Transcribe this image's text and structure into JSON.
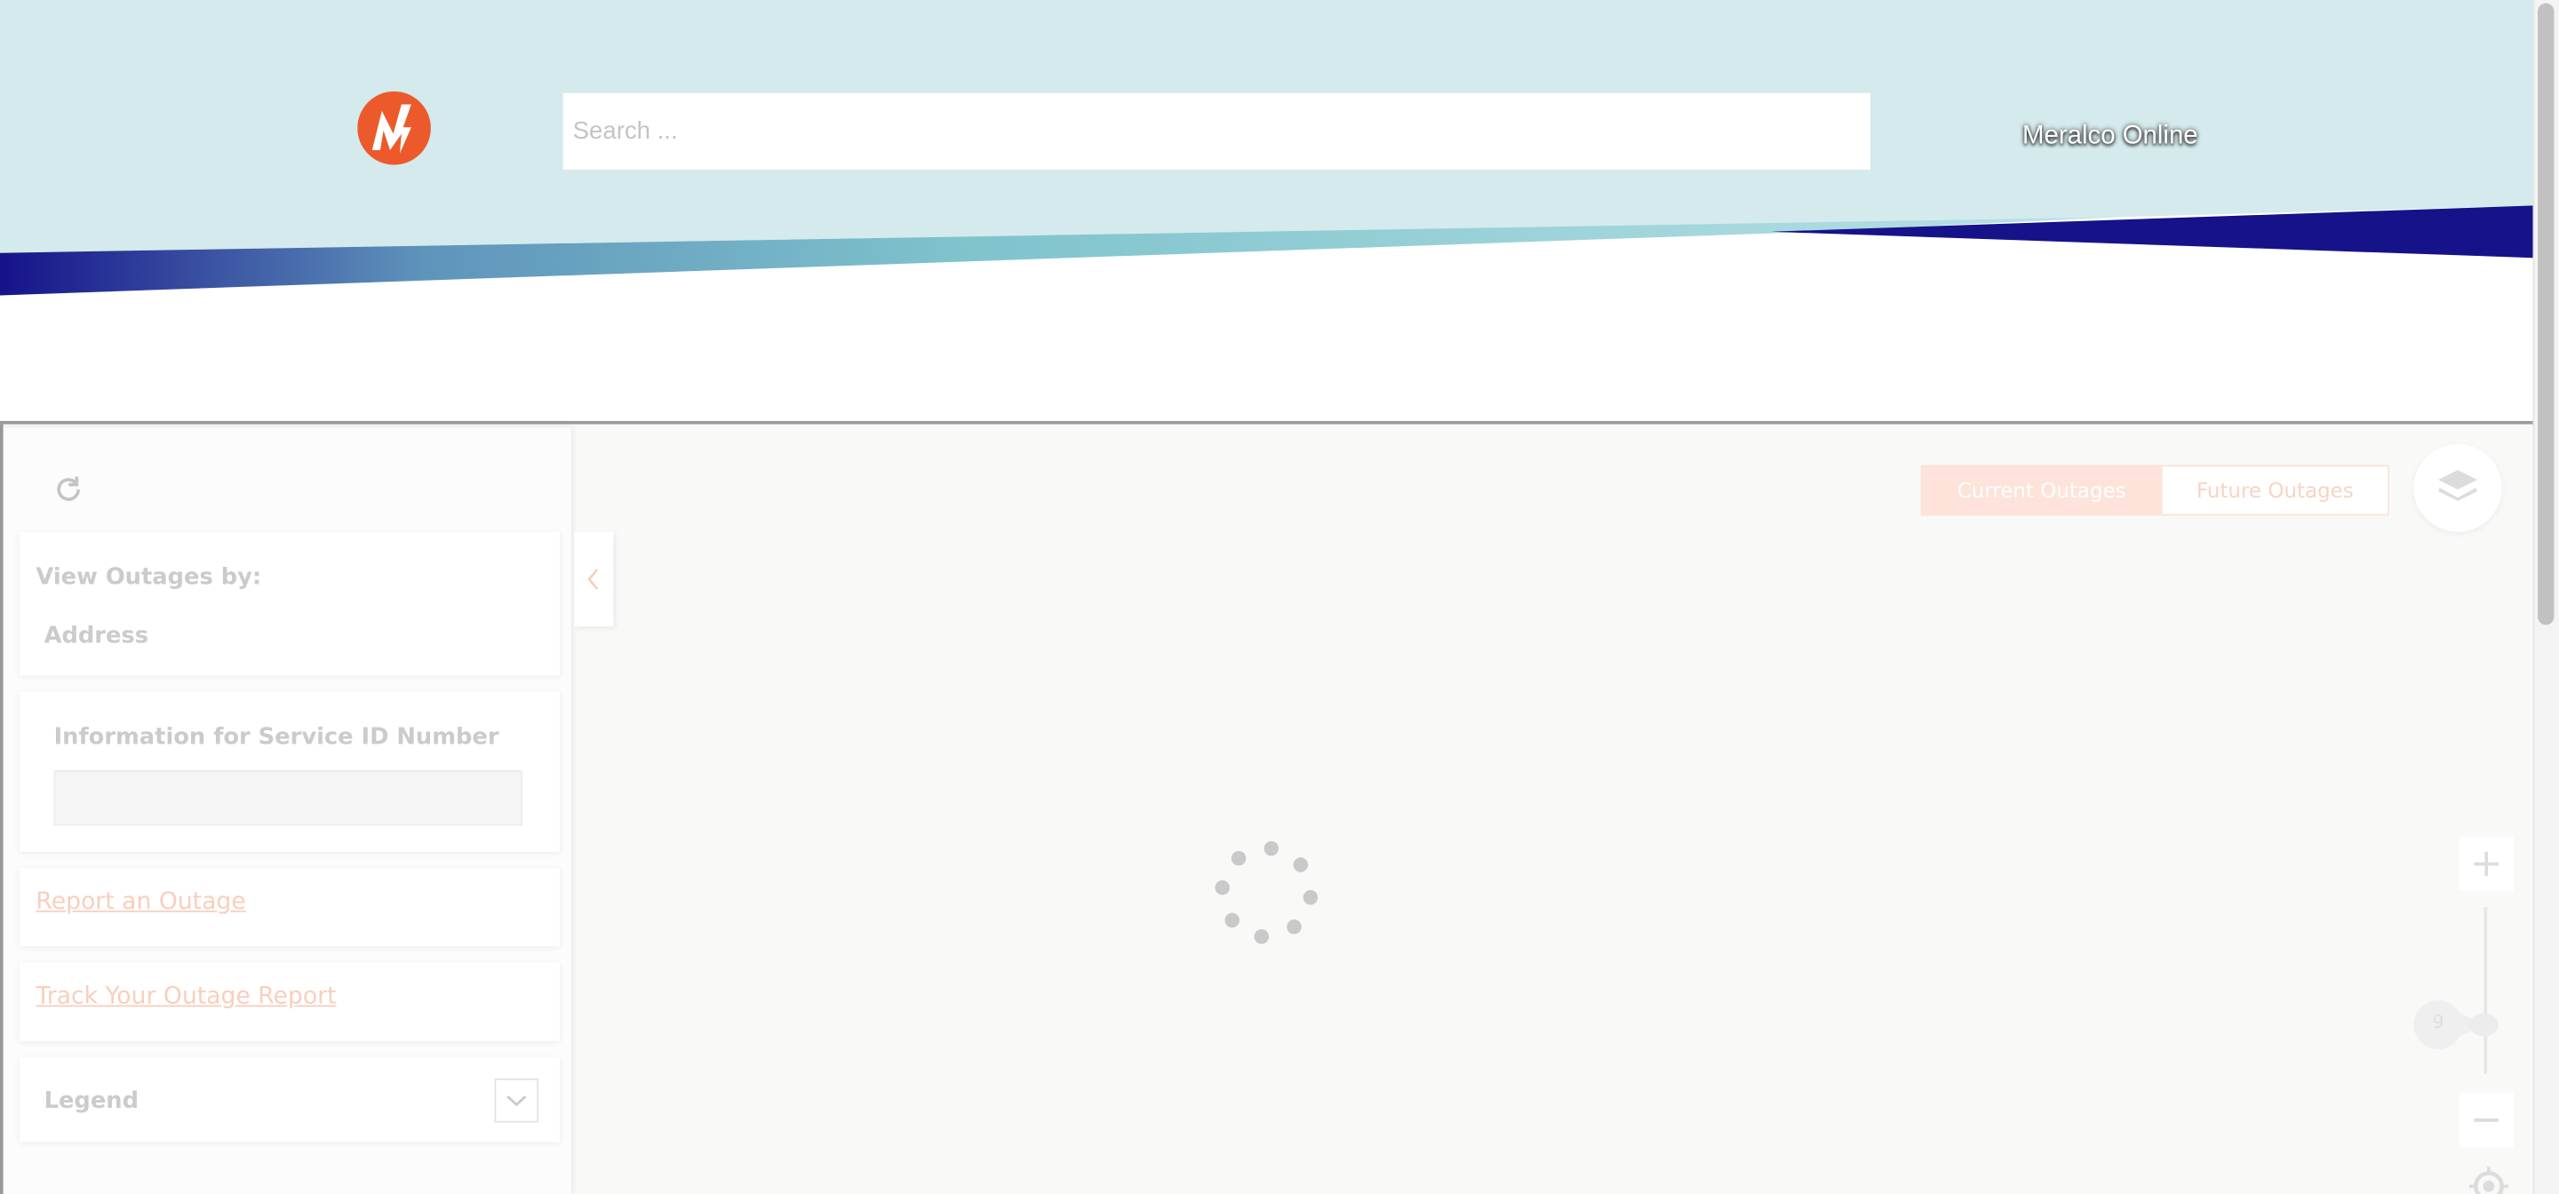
{
  "header": {
    "logo_icon": "meralco-logo",
    "search_placeholder": "Search ...",
    "brand_link": "Meralco Online",
    "colors": {
      "header_bg": "#d4eaec",
      "brand_orange": "#ec5a2b",
      "navy": "#16128a",
      "teal": "#86c8cf"
    }
  },
  "panel": {
    "refresh_icon": "refresh-icon",
    "view_outages_label": "View Outages by:",
    "view_outages_value": "Address",
    "service_id_label": "Information for Service ID Number",
    "service_id_value": "",
    "report_link": "Report an Outage",
    "track_link": "Track Your Outage Report",
    "legend_label": "Legend",
    "legend_icon": "chevron-down-icon",
    "collapse_icon": "chevron-left-icon"
  },
  "map": {
    "tabs": [
      {
        "label": "Current Outages",
        "active": true
      },
      {
        "label": "Future Outages",
        "active": false
      }
    ],
    "layers_icon": "layers-icon",
    "zoom_in_icon": "plus-icon",
    "zoom_out_icon": "minus-icon",
    "zoom_level": "9",
    "locate_icon": "locate-icon",
    "loading_icon": "spinner-icon",
    "accent": "#fde3d9"
  }
}
